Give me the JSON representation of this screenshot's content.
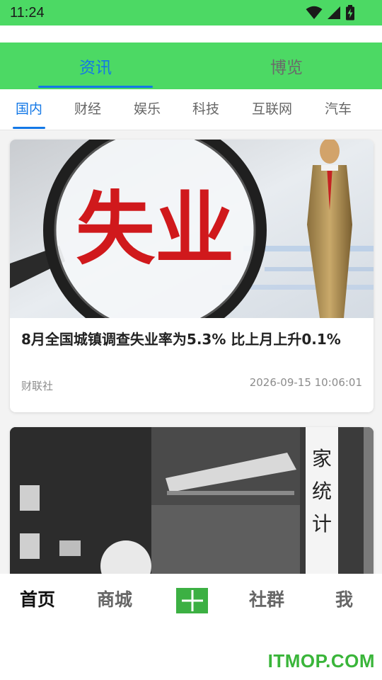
{
  "status_bar": {
    "time": "11:24",
    "icons": [
      "wifi-icon",
      "cell-signal-icon",
      "battery-charging-icon"
    ]
  },
  "header_tabs": [
    {
      "label": "资讯",
      "active": true
    },
    {
      "label": "博览",
      "active": false
    }
  ],
  "category_tabs": [
    {
      "label": "国内",
      "active": true
    },
    {
      "label": "财经",
      "active": false
    },
    {
      "label": "娱乐",
      "active": false
    },
    {
      "label": "科技",
      "active": false
    },
    {
      "label": "互联网",
      "active": false
    },
    {
      "label": "汽车",
      "active": false
    }
  ],
  "feed": {
    "items": [
      {
        "image_text": "失业",
        "title": "8月全国城镇调查失业率为5.3% 比上月上升0.1%",
        "source": "财联社",
        "time": "2026-09-15 10:06:01"
      },
      {
        "image_sign": [
          "家",
          "统",
          "计"
        ]
      }
    ]
  },
  "bottom_nav": [
    {
      "label": "首页",
      "active": true
    },
    {
      "label": "商城",
      "active": false
    },
    {
      "label": "",
      "icon": "plus-icon"
    },
    {
      "label": "社群",
      "active": false
    },
    {
      "label": "我",
      "active": false
    }
  ],
  "watermark": "ITMOP.COM",
  "colors": {
    "brand_green": "#4cd964",
    "active_blue": "#1378e6",
    "add_button_green": "#3cb043",
    "watermark_green": "#3ab53a"
  }
}
